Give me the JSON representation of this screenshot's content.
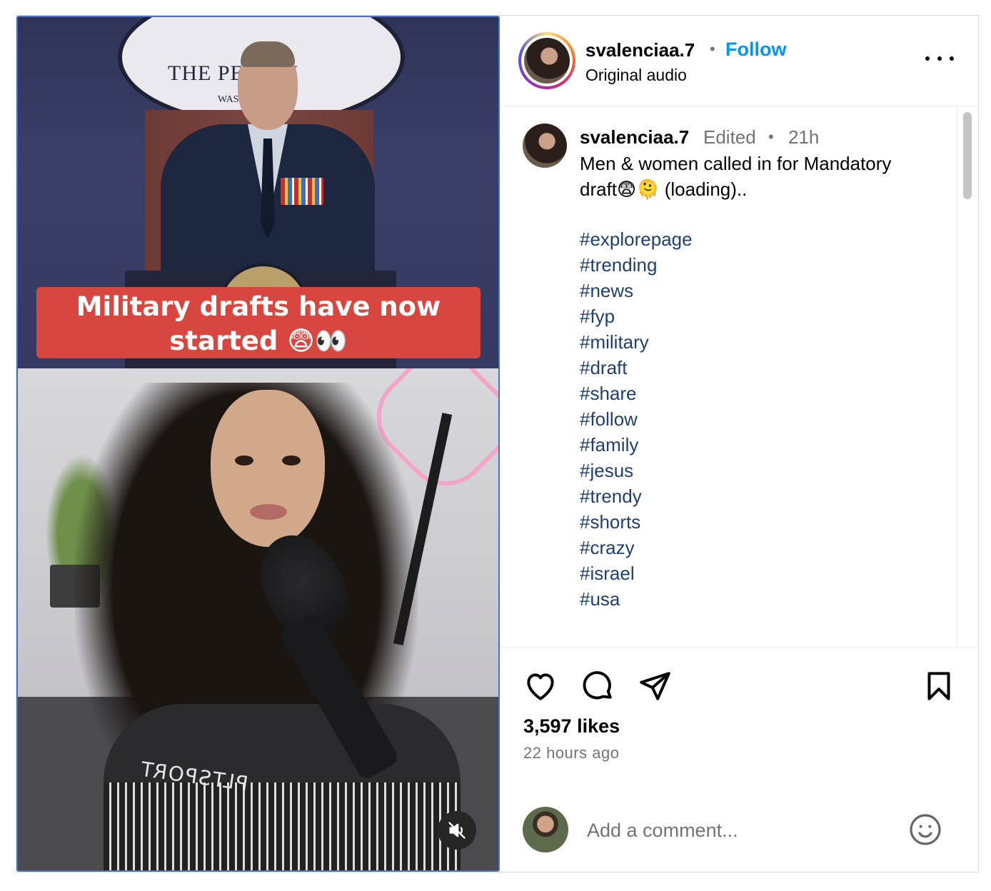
{
  "video": {
    "seal_text": "THE PE   GON",
    "seal_sub": "WAS",
    "banner_line1": "Military drafts have now",
    "banner_line2": "started 😨👀",
    "shirt_print": "PLTSPORT",
    "mute_icon": "muted-speaker-icon"
  },
  "header": {
    "username": "svalenciaa.7",
    "separator": "•",
    "follow_label": "Follow",
    "audio_label": "Original audio",
    "more_icon": "more-options-icon"
  },
  "caption": {
    "username": "svalenciaa.7",
    "edited": "Edited",
    "separator": "•",
    "time": "21h",
    "text_line1": "Men & women called in for Mandatory",
    "text_line2": "draft😨🫠 (loading)..",
    "hashtags": [
      "#explorepage",
      "#trending",
      "#news",
      "#fyp",
      "#military",
      "#draft",
      "#share",
      "#follow",
      "#family",
      "#jesus",
      "#trendy",
      "#shorts",
      "#crazy",
      "#israel",
      "#usa"
    ]
  },
  "actions": {
    "icons": [
      "heart-icon",
      "comment-icon",
      "share-icon",
      "bookmark-icon"
    ]
  },
  "stats": {
    "likes": "3,597 likes",
    "posted": "22 hours ago"
  },
  "comment": {
    "placeholder": "Add a comment...",
    "emoji_icon": "emoji-icon"
  },
  "colors": {
    "follow": "#0095f6",
    "hashtag": "#1d3f73",
    "muted": "#737373",
    "banner": "#d7463f"
  }
}
